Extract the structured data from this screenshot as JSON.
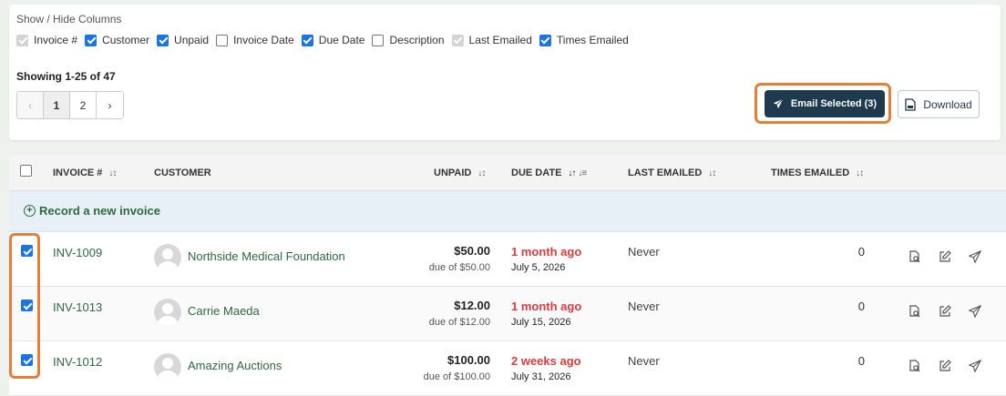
{
  "columns_panel": {
    "title": "Show / Hide Columns",
    "columns": [
      {
        "label": "Invoice #",
        "state": "disabled-checked"
      },
      {
        "label": "Customer",
        "state": "checked"
      },
      {
        "label": "Unpaid",
        "state": "checked"
      },
      {
        "label": "Invoice Date",
        "state": "unchecked"
      },
      {
        "label": "Due Date",
        "state": "checked"
      },
      {
        "label": "Description",
        "state": "unchecked"
      },
      {
        "label": "Last Emailed",
        "state": "disabled-checked"
      },
      {
        "label": "Times Emailed",
        "state": "checked"
      }
    ],
    "showing": "Showing 1-25 of 47",
    "pager": {
      "prev": "‹",
      "pages": [
        "1",
        "2"
      ],
      "next": "›",
      "current": "1"
    },
    "email_button": "Email Selected (3)",
    "download_button": "Download"
  },
  "table": {
    "headers": {
      "invoice": "INVOICE #",
      "customer": "CUSTOMER",
      "unpaid": "UNPAID",
      "due_date": "DUE DATE",
      "last_emailed": "LAST EMAILED",
      "times_emailed": "TIMES EMAILED"
    },
    "new_invoice": "Record a new invoice",
    "rows": [
      {
        "invoice": "INV-1009",
        "customer": "Northside Medical Foundation",
        "amount": "$50.00",
        "due_of": "due of $50.00",
        "ago": "1 month ago",
        "date": "July 5, 2026",
        "last_emailed": "Never",
        "times": "0",
        "checked": true
      },
      {
        "invoice": "INV-1013",
        "customer": "Carrie Maeda",
        "amount": "$12.00",
        "due_of": "due of $12.00",
        "ago": "1 month ago",
        "date": "July 15, 2026",
        "last_emailed": "Never",
        "times": "0",
        "checked": true
      },
      {
        "invoice": "INV-1012",
        "customer": "Amazing Auctions",
        "amount": "$100.00",
        "due_of": "due of $100.00",
        "ago": "2 weeks ago",
        "date": "July 31, 2026",
        "last_emailed": "Never",
        "times": "0",
        "checked": true
      }
    ]
  },
  "colors": {
    "accent_green": "#2d6a3d",
    "overdue_red": "#e03a3a",
    "primary_button": "#1e3a4f",
    "highlight": "#e67e35",
    "checkbox_blue": "#1a73e8"
  }
}
